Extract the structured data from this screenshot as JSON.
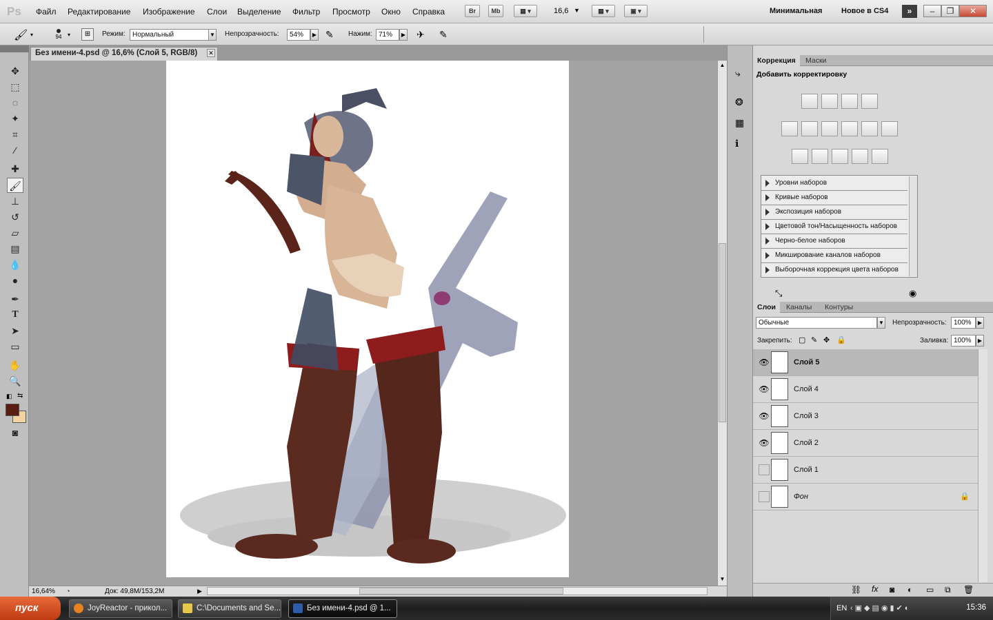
{
  "menubar": {
    "logo": "Ps",
    "items": [
      "Файл",
      "Редактирование",
      "Изображение",
      "Слои",
      "Выделение",
      "Фильтр",
      "Просмотр",
      "Окно",
      "Справка"
    ],
    "zoom": "16,6",
    "buttons": {
      "br": "Br",
      "mb": "Mb"
    },
    "workspaces": [
      "Минимальная",
      "Новое в CS4"
    ]
  },
  "options": {
    "brush_size": "94",
    "mode_label": "Режим:",
    "mode_value": "Нормальный",
    "opacity_label": "Непрозрачность:",
    "opacity_value": "54%",
    "flow_label": "Нажим:",
    "flow_value": "71%"
  },
  "document": {
    "tab_title": "Без имени-4.psd @ 16,6% (Слой 5, RGB/8)"
  },
  "status": {
    "zoom": "16,64%",
    "doc_size": "Док: 49,8M/153,2M"
  },
  "colors": {
    "foreground": "#5a1d12",
    "background": "#f1d2a0"
  },
  "adjustments": {
    "tabs": [
      "Коррекция",
      "Маски"
    ],
    "title": "Добавить корректировку",
    "presets": [
      "Уровни наборов",
      "Кривые наборов",
      "Экспозиция наборов",
      "Цветовой тон/Насыщенность наборов",
      "Черно-белое наборов",
      "Микширование каналов наборов",
      "Выборочная коррекция цвета наборов"
    ]
  },
  "layers_panel": {
    "tabs": [
      "Слои",
      "Каналы",
      "Контуры"
    ],
    "blend_mode": "Обычные",
    "opacity_label": "Непрозрачность:",
    "opacity_value": "100%",
    "lock_label": "Закрепить:",
    "fill_label": "Заливка:",
    "fill_value": "100%",
    "layers": [
      {
        "name": "Слой 5",
        "visible": true,
        "selected": true
      },
      {
        "name": "Слой 4",
        "visible": true,
        "selected": false
      },
      {
        "name": "Слой 3",
        "visible": true,
        "selected": false
      },
      {
        "name": "Слой 2",
        "visible": true,
        "selected": false
      },
      {
        "name": "Слой 1",
        "visible": false,
        "selected": false
      },
      {
        "name": "Фон",
        "visible": false,
        "selected": false,
        "locked": true
      }
    ]
  },
  "taskbar": {
    "start": "пуск",
    "tasks": [
      "JoyReactor - прикол...",
      "C:\\Documents and Se...",
      "Без имени-4.psd @ 1..."
    ],
    "lang": "EN",
    "clock": "15:36"
  }
}
